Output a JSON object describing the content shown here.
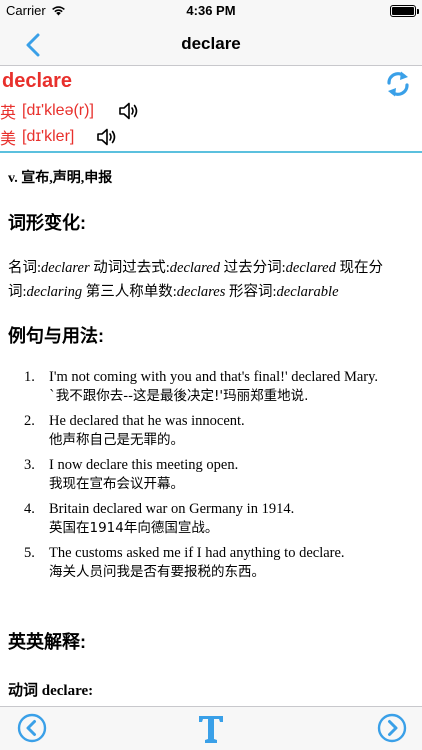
{
  "status_bar": {
    "carrier": "Carrier",
    "time": "4:36 PM"
  },
  "nav": {
    "title": "declare",
    "back_icon": "chevron-left-icon"
  },
  "word": {
    "headword": "declare",
    "uk_label": "英",
    "uk_phonetic": "[dɪ'kleə(r)]",
    "us_label": "美",
    "us_phonetic": "[dɪ'kler]"
  },
  "content": {
    "part_of_speech": "v. 宣布,声明,申报",
    "forms_title": "词形变化:",
    "forms": [
      {
        "label": "名词:",
        "value": "declarer"
      },
      {
        "label": "动词过去式:",
        "value": "declared"
      },
      {
        "label": "过去分词:",
        "value": "declared"
      },
      {
        "label": "现在分词:",
        "value": "declaring"
      },
      {
        "label": "第三人称单数:",
        "value": "declares"
      },
      {
        "label": "形容词:",
        "value": "declarable"
      }
    ],
    "examples_title": "例句与用法:",
    "examples": [
      {
        "num": "1.",
        "en": "I'm not coming with you and that's final!' declared Mary.",
        "zh": "`我不跟你去--这是最後决定!'玛丽郑重地说."
      },
      {
        "num": "2.",
        "en": "He declared that he was innocent.",
        "zh": "他声称自己是无罪的。"
      },
      {
        "num": "3.",
        "en": "I now declare this meeting open.",
        "zh": "我现在宣布会议开幕。"
      },
      {
        "num": "4.",
        "en": "Britain declared war on Germany in 1914.",
        "zh": "英国在1914年向德国宣战。"
      },
      {
        "num": "5.",
        "en": "The customs asked me if I had anything to declare.",
        "zh": "海关人员问我是否有要报税的东西。"
      }
    ],
    "definitions_title": "英英解释:",
    "definition_head": "动词 declare:"
  },
  "colors": {
    "accent": "#3aa0e8",
    "headword": "#e8302c",
    "divider": "#5bc0de"
  }
}
